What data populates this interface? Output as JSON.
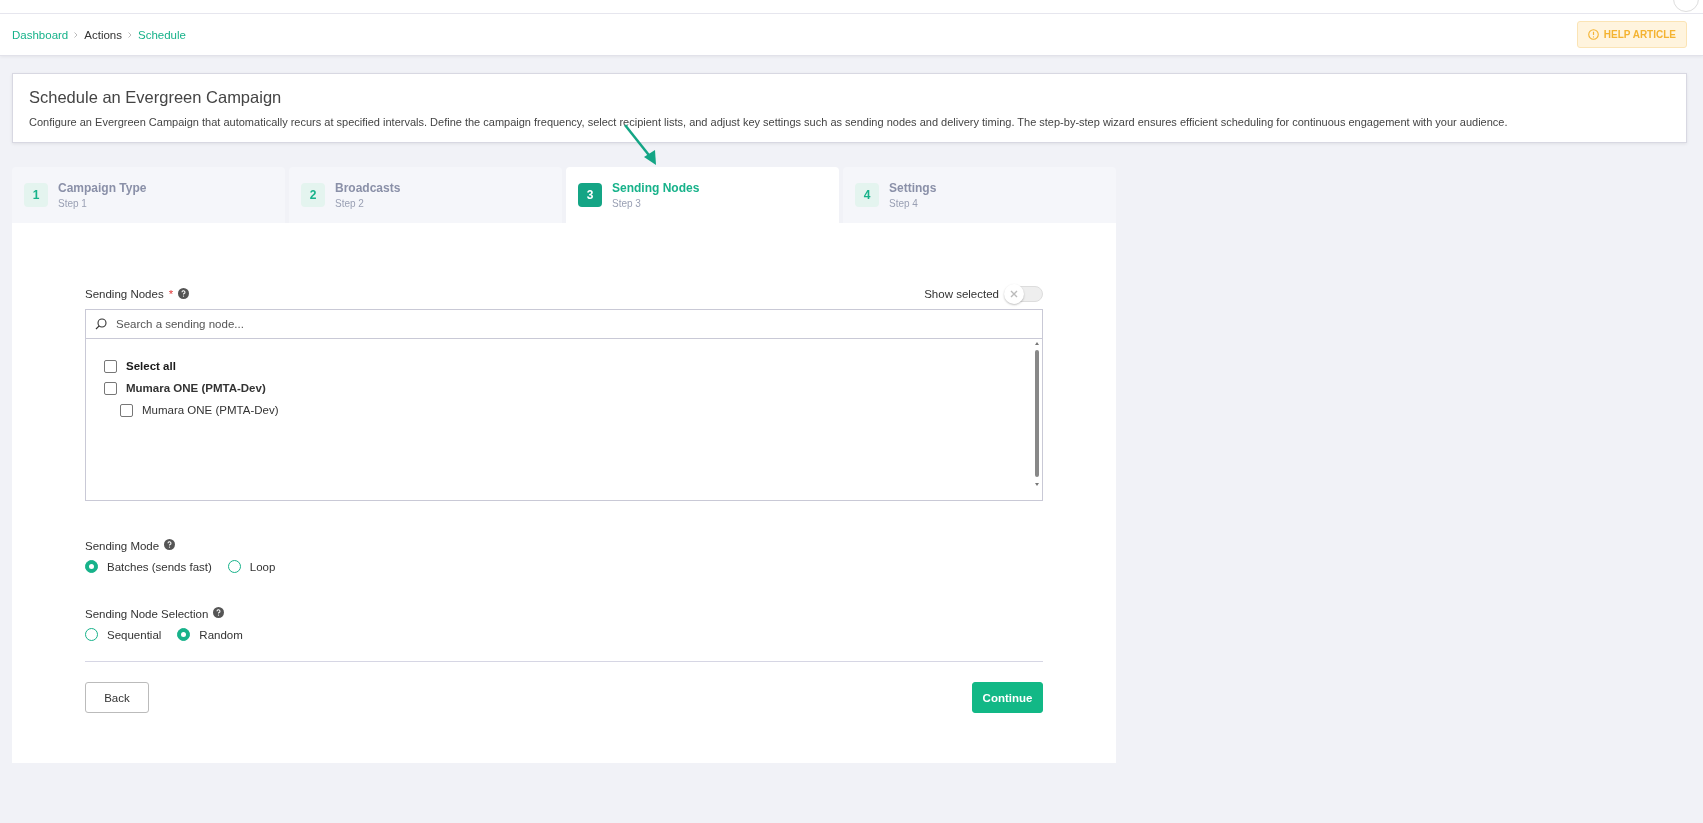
{
  "breadcrumb": [
    {
      "label": "Dashboard",
      "link": true
    },
    {
      "label": "Actions",
      "link": false
    },
    {
      "label": "Schedule",
      "link": true
    }
  ],
  "help_button": {
    "label": "HELP ARTICLE"
  },
  "header": {
    "title": "Schedule an Evergreen Campaign",
    "description": "Configure an Evergreen Campaign that automatically recurs at specified intervals. Define the campaign frequency, select recipient lists, and adjust key settings such as sending nodes and delivery timing. The step-by-step wizard ensures efficient scheduling for continuous engagement with your audience."
  },
  "steps": [
    {
      "number": "1",
      "title": "Campaign Type",
      "subtitle": "Step 1",
      "selected": false
    },
    {
      "number": "2",
      "title": "Broadcasts",
      "subtitle": "Step 2",
      "selected": false
    },
    {
      "number": "3",
      "title": "Sending Nodes",
      "subtitle": "Step 3",
      "selected": true
    },
    {
      "number": "4",
      "title": "Settings",
      "subtitle": "Step 4",
      "selected": false
    }
  ],
  "sending_nodes": {
    "label": "Sending Nodes",
    "required_mark": "*",
    "show_selected": {
      "label": "Show selected",
      "on": false
    },
    "search": {
      "placeholder": "Search a sending node..."
    },
    "items": [
      {
        "kind": "select_all",
        "label": "Select all",
        "checked": false
      },
      {
        "kind": "group",
        "label": "Mumara ONE (PMTA-Dev)",
        "checked": false,
        "children": [
          {
            "kind": "node",
            "label": "Mumara ONE (PMTA-Dev)",
            "checked": false
          }
        ]
      }
    ]
  },
  "radio_groups": [
    {
      "label": "Sending Mode",
      "options": [
        {
          "label": "Batches (sends fast)",
          "selected": true
        },
        {
          "label": "Loop",
          "selected": false
        }
      ]
    },
    {
      "label": "Sending Node Selection",
      "options": [
        {
          "label": "Sequential",
          "selected": false
        },
        {
          "label": "Random",
          "selected": true
        }
      ]
    }
  ],
  "buttons": [
    {
      "kind": "secondary",
      "label": "Back"
    },
    {
      "kind": "primary",
      "label": "Continue"
    }
  ]
}
